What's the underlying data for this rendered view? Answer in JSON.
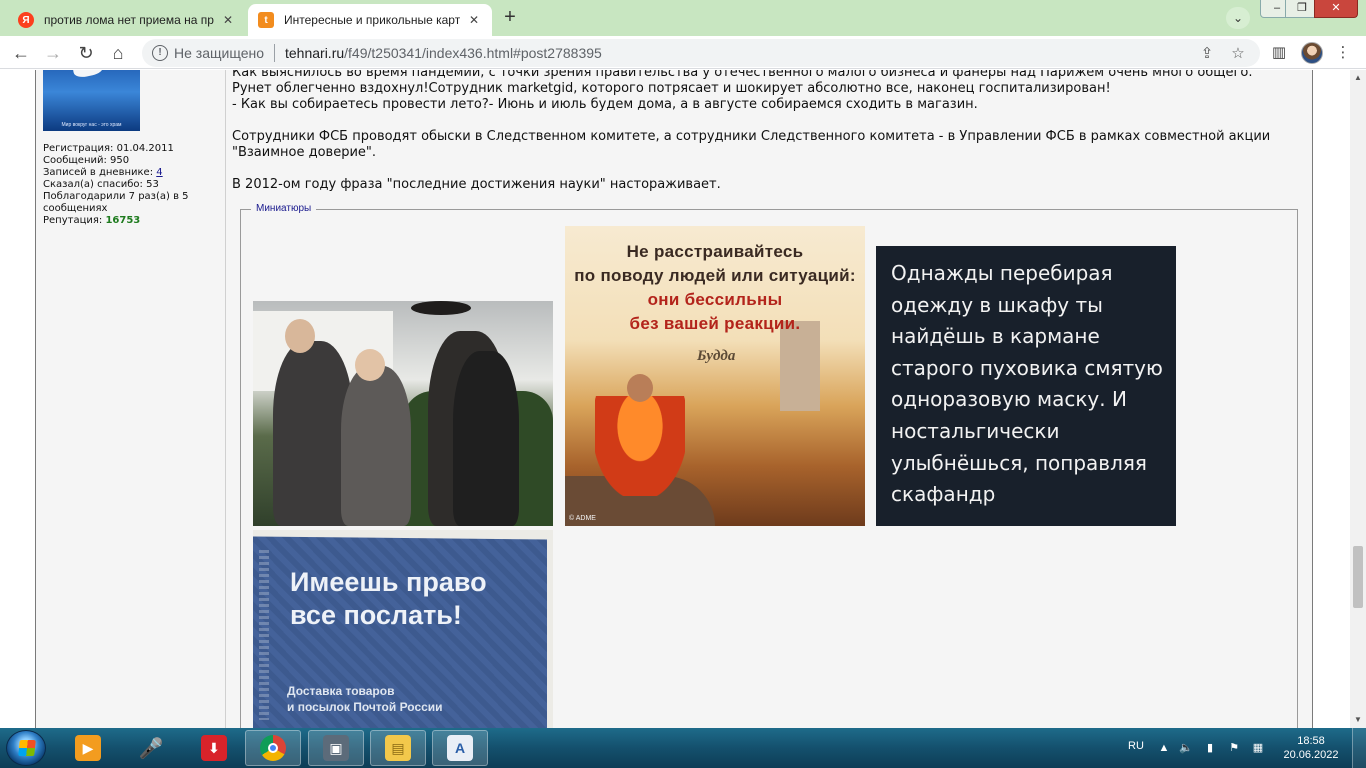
{
  "browser": {
    "tabs": [
      {
        "title": "против лома нет приема на про",
        "favicon": "yandex-icon",
        "active": false
      },
      {
        "title": "Интересные и прикольные карт",
        "favicon": "tehnari-icon",
        "active": true
      }
    ],
    "new_tab_symbol": "+",
    "security_label": "Не защищено",
    "url_host": "tehnari.ru",
    "url_path": "/f49/t250341/index436.html#post2788395"
  },
  "user_panel": {
    "avatar_caption": "Мир вокруг нас - это храм",
    "stats": [
      {
        "label": "Регистрация: ",
        "value": "01.04.2011"
      },
      {
        "label": "Сообщений: ",
        "value": "950"
      },
      {
        "label": "Записей в дневнике: ",
        "value": "4"
      },
      {
        "label": "Сказал(а) спасибо: ",
        "value": "53"
      },
      {
        "label": "Поблагодарили 7 раз(а) в 5 сообщениях",
        "value": ""
      },
      {
        "label": "Репутация: ",
        "value": "16753"
      }
    ]
  },
  "post": {
    "paragraphs": [
      "Как выяснилось во время пандемии, с точки зрения правительства у отечественного малого бизнеса и фанеры над Парижем очень много общего.",
      "Рунет облегченно вздохнул!Сотрудник marketgid, которого потрясает и шокирует абсолютно все, наконец госпитализирован!",
      "- Как вы собираетесь провести лето?- Июнь и июль будем дома, а в августе собираемся сходить в магазин.",
      "Сотрудники ФСБ проводят обыски в Следственном комитете, а сотрудники Следственного комитета - в Управлении ФСБ в рамках совместной акции \"Взаимное доверие\".",
      "В 2012-ом году фраза \"последние достижения науки\" настораживает."
    ],
    "thumbnails_legend": "Миниатюры",
    "buddha_image": {
      "lines": [
        "Не расстраивайтесь",
        "по поводу людей или ситуаций:",
        "они бессильны",
        "без вашей реакции."
      ],
      "author": "Будда",
      "watermark": "© ADME"
    },
    "dark_image_text": "Однажды перебирая одежду в шкафу ты найдёшь в кармане старого пуховика смятую одноразовую маску. И ностальгически улыбнёшься, поправляя скафандр",
    "poster_image": {
      "title_line1": "Имеешь право",
      "title_line2": "все послать!",
      "sub_line1": "Доставка товаров",
      "sub_line2": "и посылок Почтой России"
    }
  },
  "taskbar": {
    "language": "RU",
    "time": "18:58",
    "date": "20.06.2022"
  },
  "colors": {
    "tabstrip": "#c8e6c1",
    "reputation": "#1e7b1e",
    "link": "#1a1a8e",
    "taskbar": "#14506d"
  }
}
